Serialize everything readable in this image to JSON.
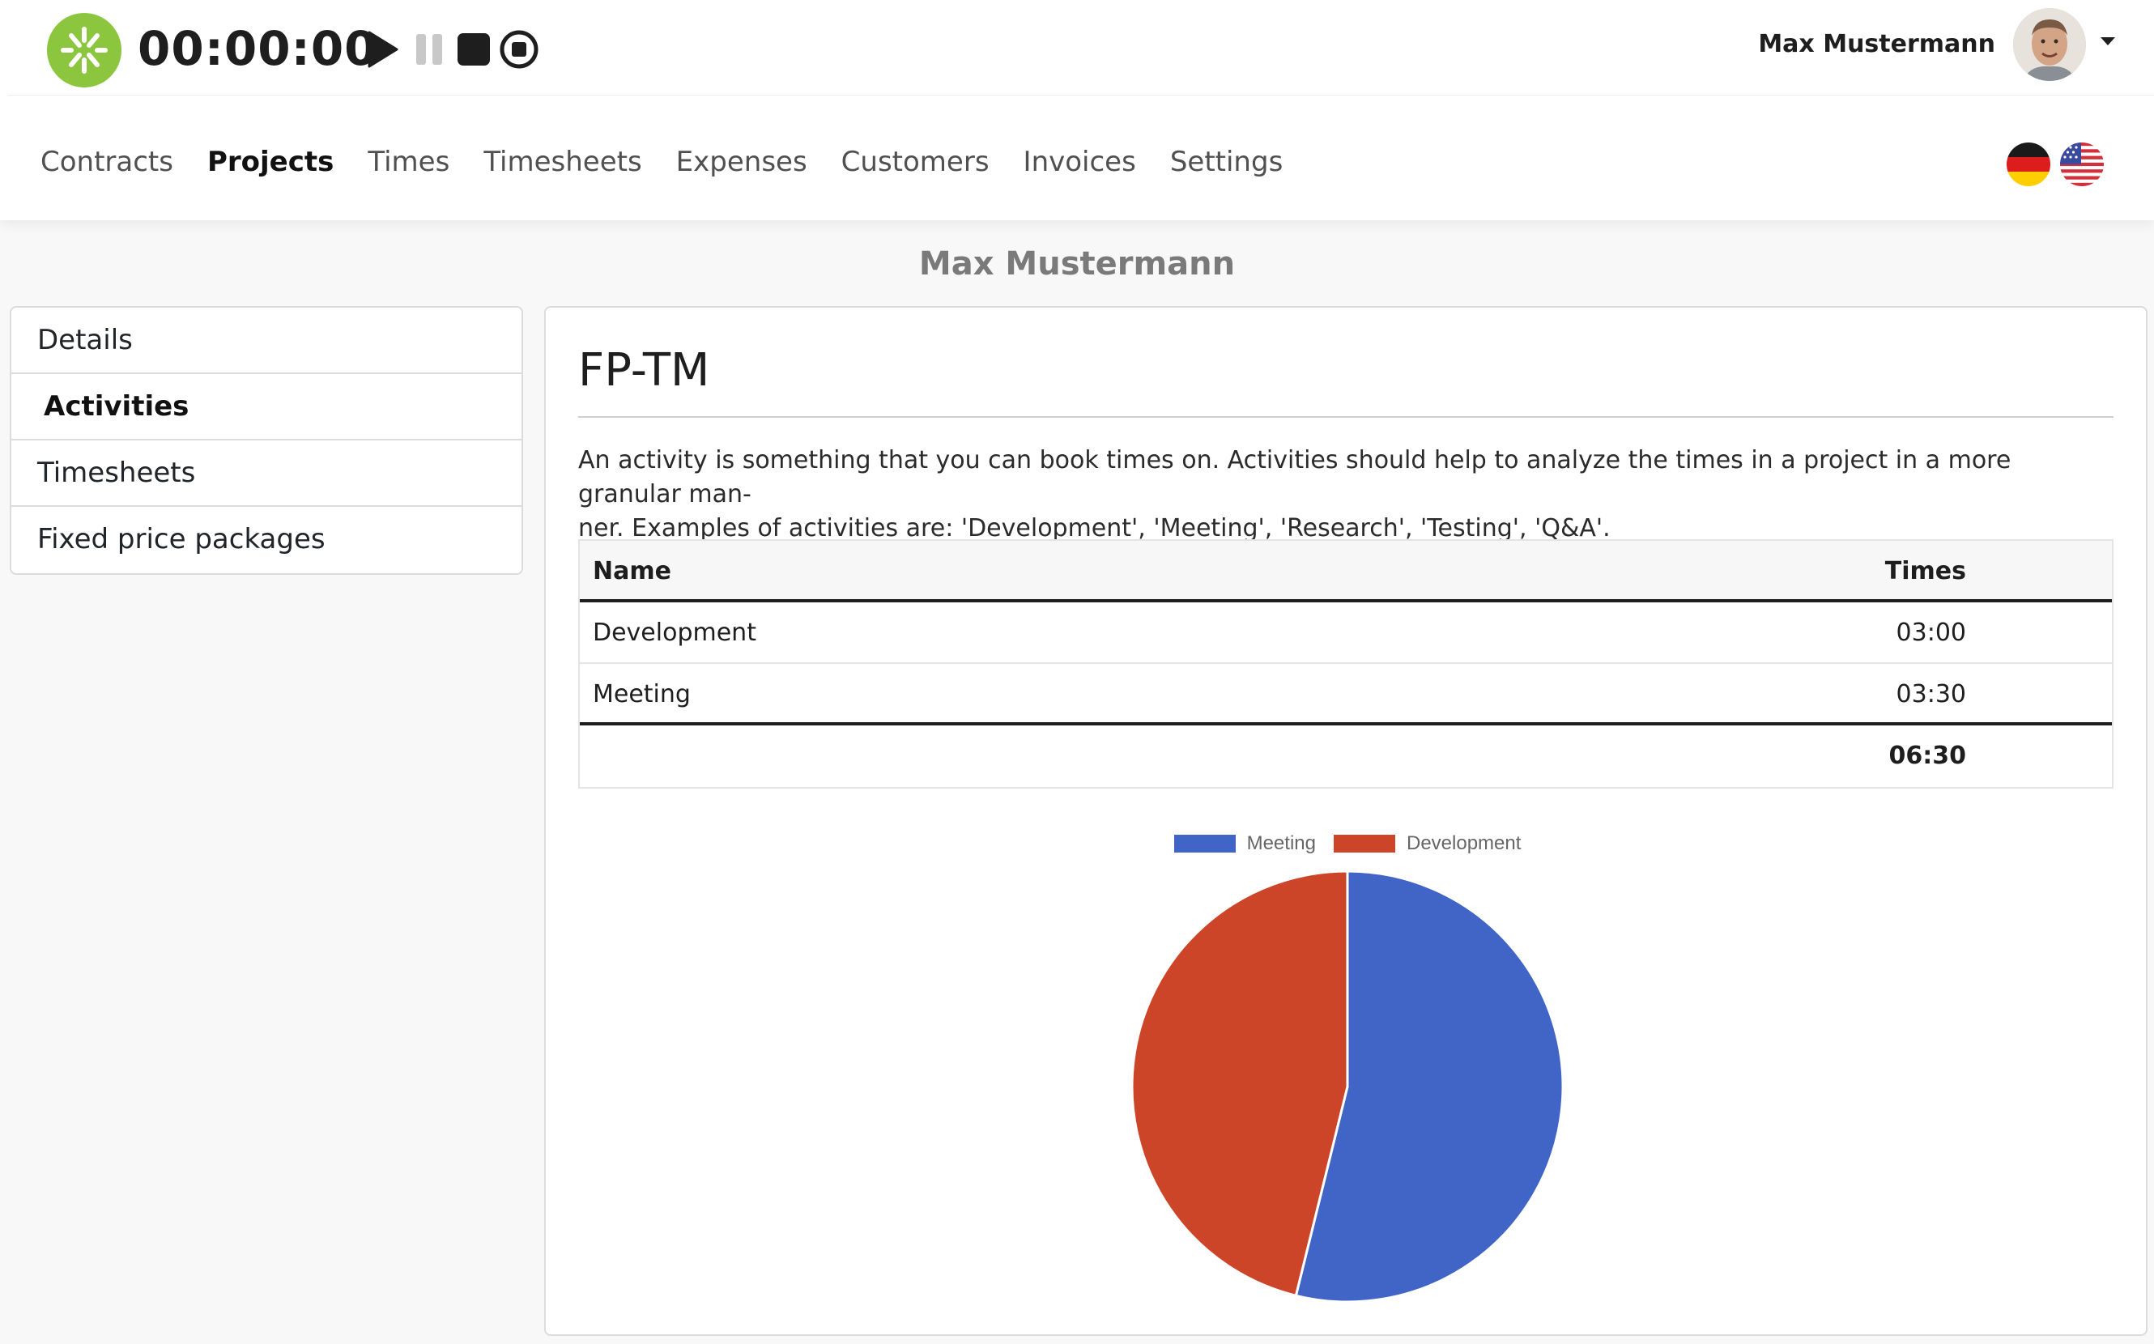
{
  "app": {
    "timer": "00:00:00",
    "user_name": "Max Mustermann",
    "brand_color": "#8cc63f"
  },
  "nav": {
    "items": [
      {
        "label": "Contracts",
        "active": false
      },
      {
        "label": "Projects",
        "active": true
      },
      {
        "label": "Times",
        "active": false
      },
      {
        "label": "Timesheets",
        "active": false
      },
      {
        "label": "Expenses",
        "active": false
      },
      {
        "label": "Customers",
        "active": false
      },
      {
        "label": "Invoices",
        "active": false
      },
      {
        "label": "Settings",
        "active": false
      }
    ],
    "languages": [
      "de-flag-icon",
      "us-flag-icon"
    ]
  },
  "page": {
    "heading": "Max Mustermann"
  },
  "sidebar": {
    "items": [
      {
        "label": "Details",
        "active": false
      },
      {
        "label": "Activities",
        "active": true
      },
      {
        "label": "Timesheets",
        "active": false
      },
      {
        "label": "Fixed price packages",
        "active": false
      }
    ]
  },
  "project": {
    "title": "FP-TM",
    "description_line1": "An activity is something that you can book times on. Activities should help to analyze the times in a project in a more granular man-",
    "description_line2": "ner. Examples of activities are: 'Development', 'Meeting', 'Research', 'Testing', 'Q&A'."
  },
  "table": {
    "headers": {
      "name": "Name",
      "times": "Times"
    },
    "rows": [
      {
        "name": "Development",
        "times": "03:00"
      },
      {
        "name": "Meeting",
        "times": "03:30"
      }
    ],
    "total": "06:30"
  },
  "chart_data": {
    "type": "pie",
    "legend_position": "top",
    "slices": [
      {
        "label": "Meeting",
        "value": 3.5,
        "color": "#4065c6"
      },
      {
        "label": "Development",
        "value": 3.0,
        "color": "#cc4529"
      }
    ]
  }
}
